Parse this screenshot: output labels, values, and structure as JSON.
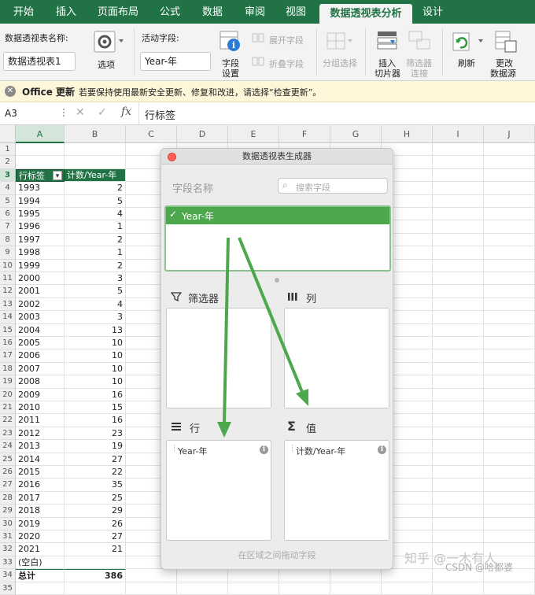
{
  "tabs": [
    "开始",
    "插入",
    "页面布局",
    "公式",
    "数据",
    "审阅",
    "视图",
    "数据透视表分析",
    "设计"
  ],
  "active_tab": "数据透视表分析",
  "ribbon": {
    "name_label": "数据透视表名称:",
    "name_value": "数据透视表1",
    "options_label": "选项",
    "active_field_label": "活动字段:",
    "active_field_value": "Year-年",
    "field_settings_label_1": "字段",
    "field_settings_label_2": "设置",
    "expand_label": "展开字段",
    "collapse_label": "折叠字段",
    "group_label": "分组选择",
    "slicer_label_1": "插入",
    "slicer_label_2": "切片器",
    "filter_conn_label_1": "筛选器",
    "filter_conn_label_2": "连接",
    "refresh_label": "刷新",
    "change_source_label_1": "更改",
    "change_source_label_2": "数据源"
  },
  "update_bar": {
    "title": "Office 更新",
    "message": "若要保持使用最新安全更新、修复和改进，请选择“检查更新”。"
  },
  "formula_bar": {
    "cell_ref": "A3",
    "fx": "fx",
    "content": "行标签"
  },
  "columns": [
    "A",
    "B",
    "C",
    "D",
    "E",
    "F",
    "G",
    "H",
    "I",
    "J"
  ],
  "rows": [
    "1",
    "2",
    "3",
    "4",
    "5",
    "6",
    "7",
    "8",
    "9",
    "10",
    "11",
    "12",
    "13",
    "14",
    "15",
    "16",
    "17",
    "18",
    "19",
    "20",
    "21",
    "22",
    "23",
    "24",
    "25",
    "26",
    "27",
    "28",
    "29",
    "30",
    "31",
    "32",
    "33",
    "34",
    "35"
  ],
  "pivot": {
    "header_label": "行标签",
    "header_value": "计数/Year-年",
    "years": [
      "1993",
      "1994",
      "1995",
      "1996",
      "1997",
      "1998",
      "1999",
      "2000",
      "2001",
      "2002",
      "2003",
      "2004",
      "2005",
      "2006",
      "2007",
      "2008",
      "2009",
      "2010",
      "2011",
      "2012",
      "2013",
      "2014",
      "2015",
      "2016",
      "2017",
      "2018",
      "2019",
      "2020",
      "2021"
    ],
    "counts": [
      "2",
      "5",
      "4",
      "1",
      "2",
      "1",
      "2",
      "3",
      "5",
      "4",
      "3",
      "13",
      "10",
      "10",
      "10",
      "10",
      "16",
      "15",
      "16",
      "23",
      "19",
      "27",
      "22",
      "35",
      "25",
      "29",
      "26",
      "27",
      "21"
    ],
    "blank_label": "(空白)",
    "total_label": "总计",
    "total_value": "386"
  },
  "panel": {
    "title": "数据透视表生成器",
    "field_name_label": "字段名称",
    "search_placeholder": "搜索字段",
    "field": "Year-年",
    "filters_label": "筛选器",
    "columns_label": "列",
    "rows_label": "行",
    "values_label": "值",
    "rows_item": "Year-年",
    "values_item": "计数/Year-年",
    "footer": "在区域之间拖动字段"
  },
  "watermark": {
    "line1": "知乎 @一木有人",
    "line2": "CSDN @哈都婆"
  },
  "colors": {
    "excel_green": "#217346",
    "arrow_green": "#4da84d",
    "header_green": "#217346"
  }
}
